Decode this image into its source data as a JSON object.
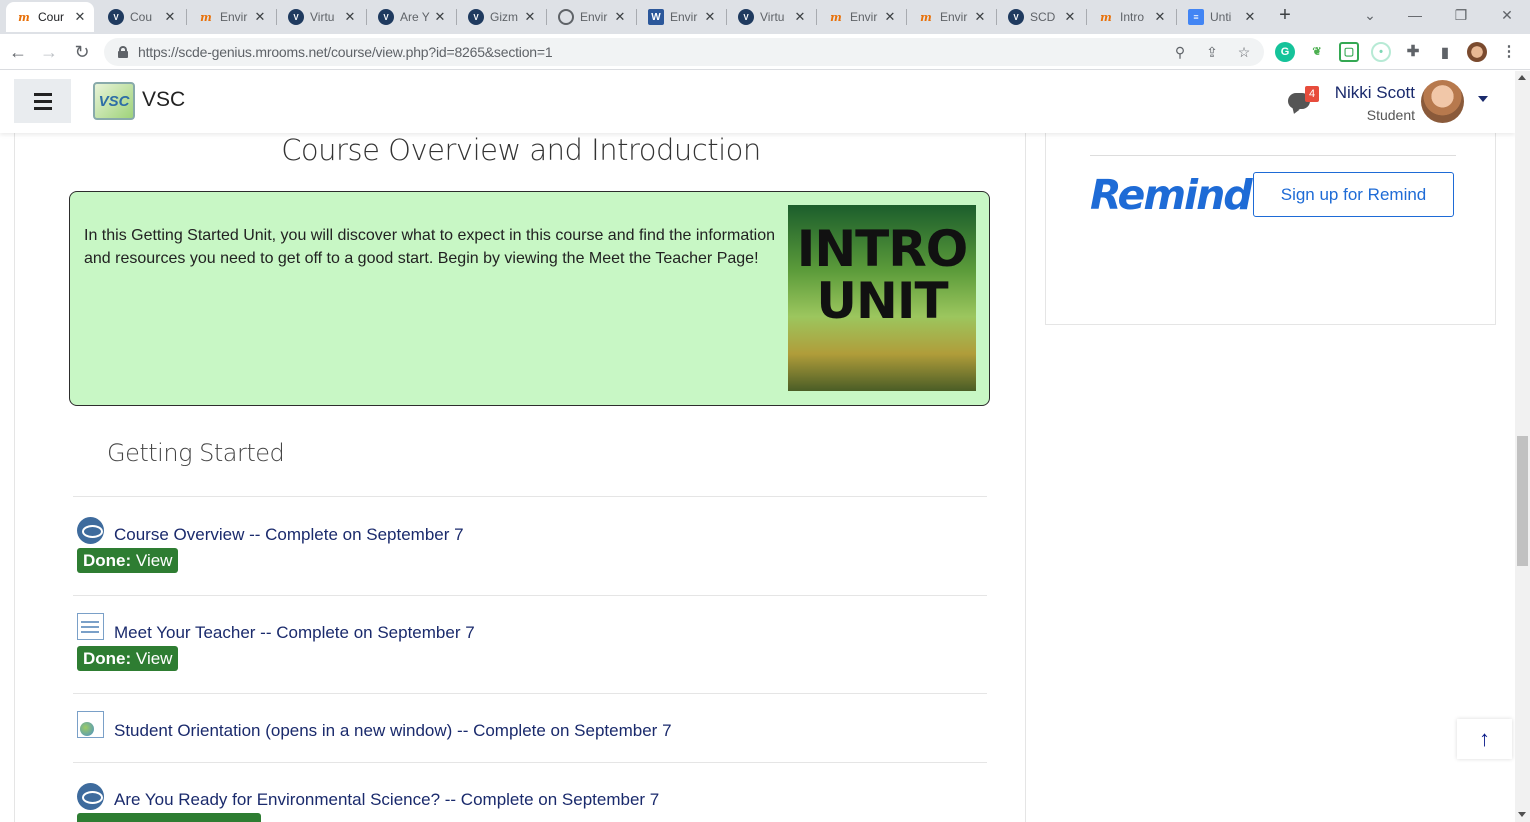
{
  "browser": {
    "tabs": [
      {
        "label": "Cour",
        "icon": "m",
        "active": true
      },
      {
        "label": "Cou",
        "icon": "vsc"
      },
      {
        "label": "Envir",
        "icon": "m"
      },
      {
        "label": "Virtu",
        "icon": "vsc"
      },
      {
        "label": "Are Y",
        "icon": "vsc"
      },
      {
        "label": "Gizm",
        "icon": "vsc"
      },
      {
        "label": "Envir",
        "icon": "globe"
      },
      {
        "label": "Envir",
        "icon": "word"
      },
      {
        "label": "Virtu",
        "icon": "vsc"
      },
      {
        "label": "Envir",
        "icon": "m"
      },
      {
        "label": "Envir",
        "icon": "m"
      },
      {
        "label": "SCD",
        "icon": "vsc"
      },
      {
        "label": "Intro",
        "icon": "m"
      },
      {
        "label": "Unti",
        "icon": "doc"
      }
    ],
    "new_tab": "+",
    "url": "https://scde-genius.mrooms.net/course/view.php?id=8265&section=1"
  },
  "navbar": {
    "brand": "VSC",
    "logo_text": "VSC",
    "chat_count": "4",
    "user_name": "Nikki Scott",
    "user_role": "Student"
  },
  "main": {
    "section_title": "Course Overview and Introduction",
    "intro_text": "In this Getting Started Unit, you will discover what to expect in this course and find the information and resources you need to get off to a good start. Begin by viewing the Meet the Teacher Page!",
    "intro_image_text": "INTRO UNIT",
    "subsection_title": "Getting Started",
    "activities": [
      {
        "title": "Course Overview -- Complete on September 7",
        "icon": "vsc-icon",
        "done_label": "Done:",
        "done_action": "View"
      },
      {
        "title": "Meet Your Teacher -- Complete on September 7",
        "icon": "page-icon",
        "done_label": "Done:",
        "done_action": "View"
      },
      {
        "title": "Student Orientation (opens in a new window) -- Complete on September 7",
        "icon": "url-icon"
      },
      {
        "title": "Are You Ready for Environmental Science? -- Complete on September 7",
        "icon": "vsc-icon"
      }
    ]
  },
  "sidebar": {
    "remind_logo": "Remind",
    "remind_button": "Sign up for Remind"
  },
  "colors": {
    "intro_bg": "#c8f7c5",
    "done_badge": "#2e7d32",
    "link": "#1a2a6c",
    "remind_blue": "#1e6bd6"
  }
}
